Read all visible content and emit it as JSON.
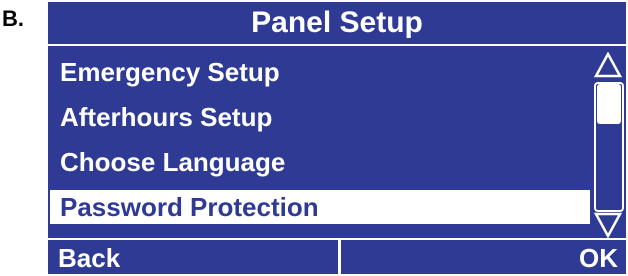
{
  "figure_label": "B.",
  "screen": {
    "title": "Panel Setup",
    "menu_items": [
      {
        "label": "Emergency Setup"
      },
      {
        "label": "Afterhours Setup"
      },
      {
        "label": "Choose Language"
      },
      {
        "label": "Password Protection",
        "selected": true
      }
    ],
    "scrollbar": {
      "up_icon": "triangle-up-outline-icon",
      "down_icon": "triangle-down-outline-icon"
    },
    "footer": {
      "left_label": "Back",
      "right_label": "OK"
    }
  },
  "colors": {
    "screen_background": "#2e3a94",
    "foreground": "#ffffff",
    "selected_text": "#2e3a94"
  }
}
